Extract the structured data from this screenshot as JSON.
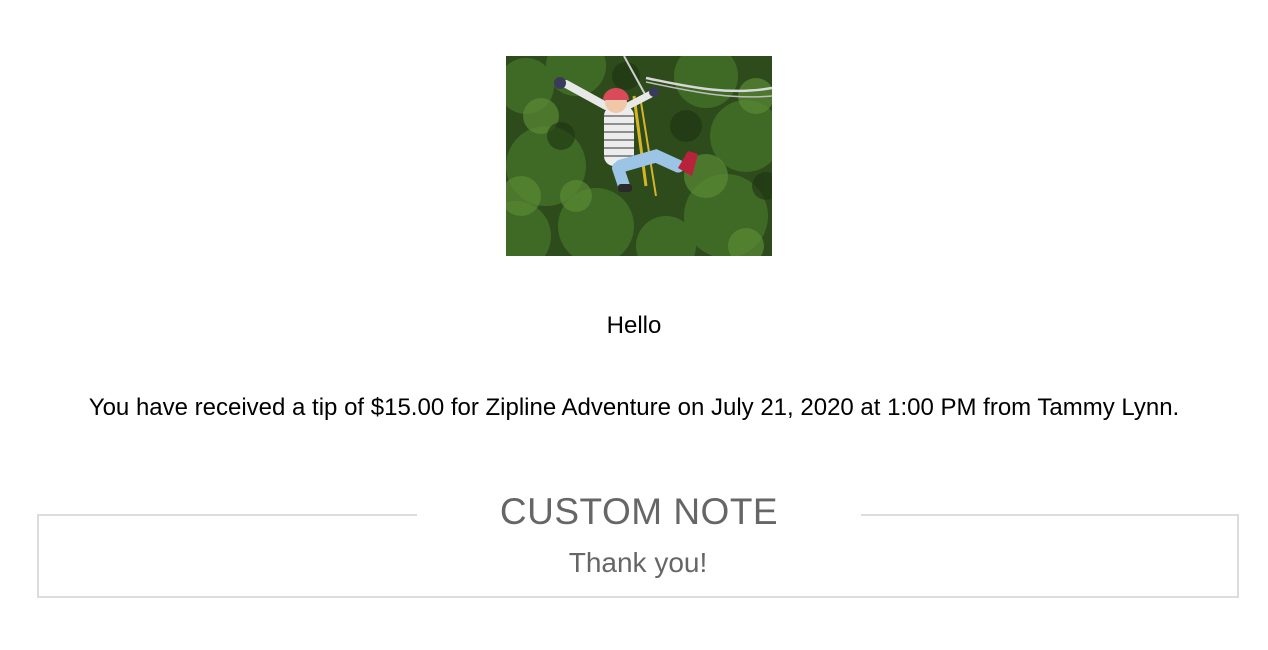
{
  "email": {
    "hero_image": {
      "alt": "zipline-photo"
    },
    "greeting": "Hello",
    "message": "You have received a tip of $15.00 for Zipline Adventure on July 21, 2020 at 1:00 PM from Tammy Lynn.",
    "custom_note": {
      "title": "CUSTOM NOTE",
      "text": "Thank you!"
    }
  },
  "colors": {
    "text_primary": "#000000",
    "text_muted": "#666666",
    "border": "#dcdcdc"
  }
}
